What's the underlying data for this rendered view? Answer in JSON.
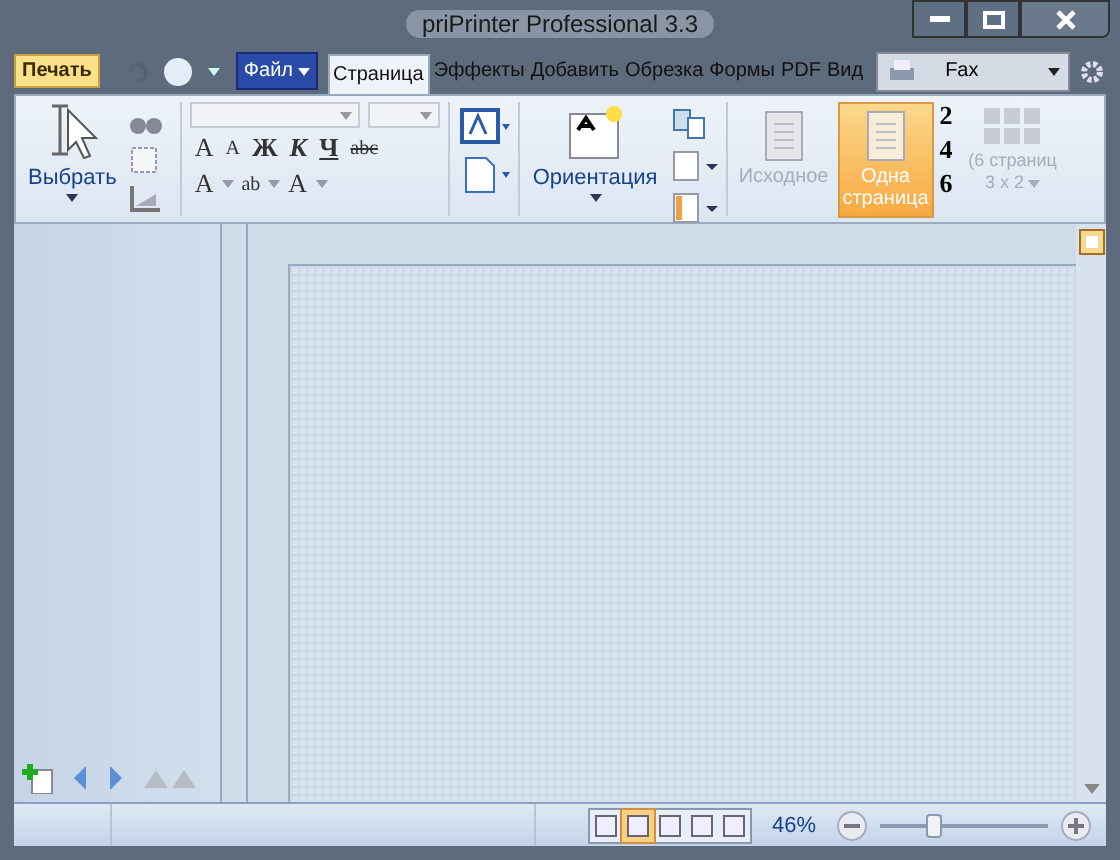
{
  "window": {
    "title": "priPrinter Professional 3.3"
  },
  "quick_access": {
    "print_button": "Печать",
    "file_menu": "Файл"
  },
  "tabs": [
    {
      "label": "Страница",
      "selected": true
    },
    {
      "label": "Эффекты",
      "selected": false
    },
    {
      "label": "Добавить",
      "selected": false
    },
    {
      "label": "Обрезка",
      "selected": false
    },
    {
      "label": "Формы",
      "selected": false
    },
    {
      "label": "PDF",
      "selected": false
    },
    {
      "label": "Вид",
      "selected": false
    }
  ],
  "printer": {
    "value": "Fax"
  },
  "ribbon": {
    "select_button": "Выбрать",
    "format_buttons": [
      {
        "label": "A",
        "kind": "grow"
      },
      {
        "label": "A",
        "kind": "shrink"
      },
      {
        "label": "Ж",
        "kind": "bold"
      },
      {
        "label": "К",
        "kind": "italic"
      },
      {
        "label": "Ч",
        "kind": "underline"
      },
      {
        "label": "abc",
        "kind": "strike"
      }
    ],
    "color_buttons": [
      {
        "label": "A",
        "kind": "eraser"
      },
      {
        "label": "ab",
        "kind": "highlight"
      },
      {
        "label": "A",
        "kind": "color"
      }
    ],
    "orientation_button": "Ориентация",
    "views": [
      {
        "label": "Исходное",
        "selected": false,
        "disabled": true
      },
      {
        "label": "Одна страница",
        "selected": true,
        "disabled": false
      }
    ],
    "page_counts": [
      "2",
      "4",
      "6"
    ],
    "multi_page": {
      "label": "(6 страниц",
      "sub": "3 x 2",
      "disabled": true
    }
  },
  "status_bar": {
    "view_modes": [
      {
        "selected": false
      },
      {
        "selected": true
      },
      {
        "selected": false
      },
      {
        "selected": false
      },
      {
        "selected": false
      }
    ],
    "zoom": "46%",
    "zoom_slider": {
      "level": 0.27
    }
  }
}
